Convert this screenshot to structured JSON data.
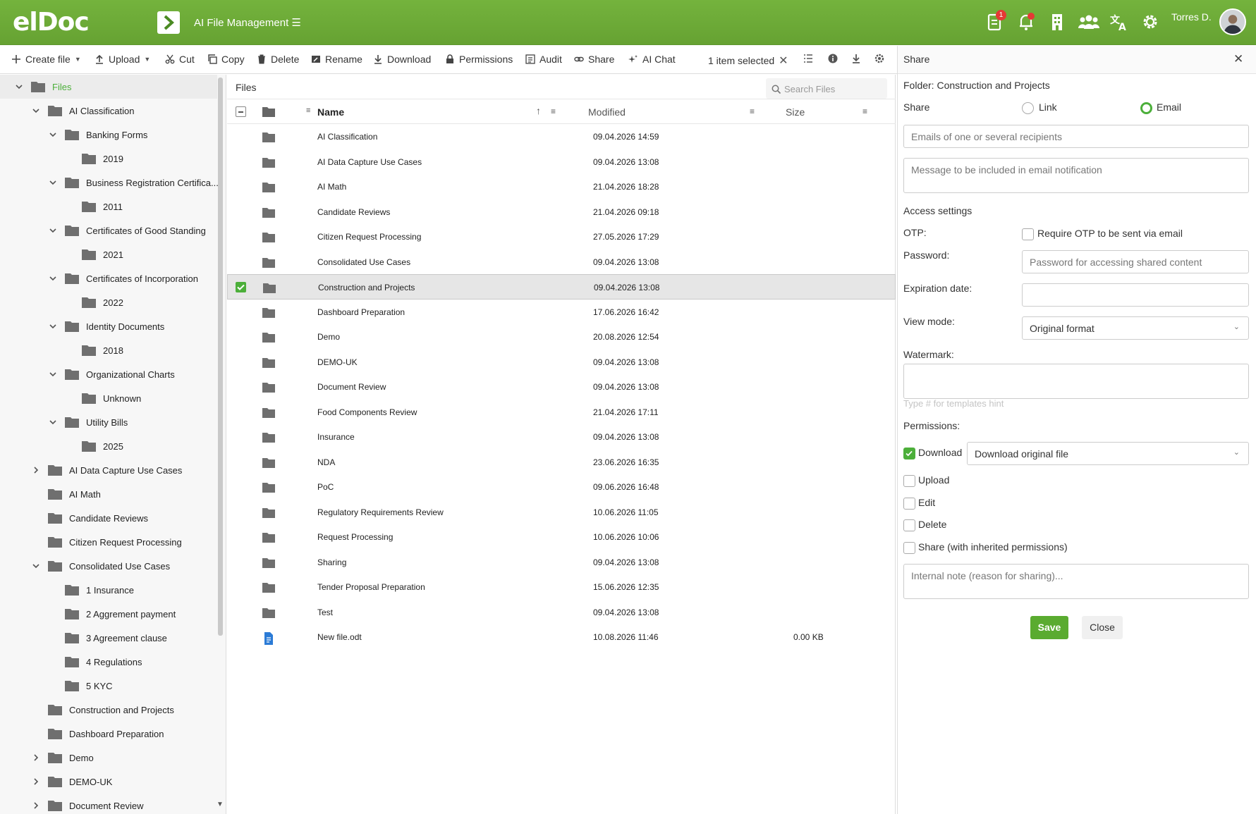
{
  "header": {
    "logo": "elDoc",
    "app_title": "AI File Management ☰",
    "notification_badge": "1",
    "user_name": "Torres D."
  },
  "toolbar": {
    "create_file": "Create file",
    "upload": "Upload",
    "cut": "Cut",
    "copy": "Copy",
    "delete": "Delete",
    "rename": "Rename",
    "download": "Download",
    "permissions": "Permissions",
    "audit": "Audit",
    "share": "Share",
    "ai_chat": "AI Chat",
    "selection_status": "1 item selected"
  },
  "tree": {
    "items": [
      {
        "label": "Files"
      },
      {
        "label": "AI Classification"
      },
      {
        "label": "Banking Forms"
      },
      {
        "label": "2019"
      },
      {
        "label": "Business Registration Certifica..."
      },
      {
        "label": "2011"
      },
      {
        "label": "Certificates of Good Standing"
      },
      {
        "label": "2021"
      },
      {
        "label": "Certificates of Incorporation"
      },
      {
        "label": "2022"
      },
      {
        "label": "Identity Documents"
      },
      {
        "label": "2018"
      },
      {
        "label": "Organizational Charts"
      },
      {
        "label": "Unknown"
      },
      {
        "label": "Utility Bills"
      },
      {
        "label": "2025"
      },
      {
        "label": "AI Data Capture Use Cases"
      },
      {
        "label": "AI Math"
      },
      {
        "label": "Candidate Reviews"
      },
      {
        "label": "Citizen Request Processing"
      },
      {
        "label": "Consolidated Use Cases"
      },
      {
        "label": "1 Insurance"
      },
      {
        "label": "2 Aggrement payment"
      },
      {
        "label": "3 Agreement clause"
      },
      {
        "label": "4 Regulations"
      },
      {
        "label": "5 KYC"
      },
      {
        "label": "Construction and Projects"
      },
      {
        "label": "Dashboard Preparation"
      },
      {
        "label": "Demo"
      },
      {
        "label": "DEMO-UK"
      },
      {
        "label": "Document Review"
      }
    ]
  },
  "list": {
    "title": "Files",
    "search_placeholder": "Search Files",
    "columns": {
      "name": "Name",
      "modified": "Modified",
      "size": "Size"
    },
    "rows": [
      {
        "name": "AI Classification",
        "modified": "09.04.2026 14:59",
        "size": ""
      },
      {
        "name": "AI Data Capture Use Cases",
        "modified": "09.04.2026 13:08",
        "size": ""
      },
      {
        "name": "AI Math",
        "modified": "21.04.2026 18:28",
        "size": ""
      },
      {
        "name": "Candidate Reviews",
        "modified": "21.04.2026 09:18",
        "size": ""
      },
      {
        "name": "Citizen Request Processing",
        "modified": "27.05.2026 17:29",
        "size": ""
      },
      {
        "name": "Consolidated Use Cases",
        "modified": "09.04.2026 13:08",
        "size": ""
      },
      {
        "name": "Construction and Projects",
        "modified": "09.04.2026 13:08",
        "size": ""
      },
      {
        "name": "Dashboard Preparation",
        "modified": "17.06.2026 16:42",
        "size": ""
      },
      {
        "name": "Demo",
        "modified": "20.08.2026 12:54",
        "size": ""
      },
      {
        "name": "DEMO-UK",
        "modified": "09.04.2026 13:08",
        "size": ""
      },
      {
        "name": "Document Review",
        "modified": "09.04.2026 13:08",
        "size": ""
      },
      {
        "name": "Food Components Review",
        "modified": "21.04.2026 17:11",
        "size": ""
      },
      {
        "name": "Insurance",
        "modified": "09.04.2026 13:08",
        "size": ""
      },
      {
        "name": "NDA",
        "modified": "23.06.2026 16:35",
        "size": ""
      },
      {
        "name": "PoC",
        "modified": "09.06.2026 16:48",
        "size": ""
      },
      {
        "name": "Regulatory Requirements Review",
        "modified": "10.06.2026 11:05",
        "size": ""
      },
      {
        "name": "Request Processing",
        "modified": "10.06.2026 10:06",
        "size": ""
      },
      {
        "name": "Sharing",
        "modified": "09.04.2026 13:08",
        "size": ""
      },
      {
        "name": "Tender Proposal Preparation",
        "modified": "15.06.2026 12:35",
        "size": ""
      },
      {
        "name": "Test",
        "modified": "09.04.2026 13:08",
        "size": ""
      },
      {
        "name": "New file.odt",
        "modified": "10.08.2026 11:46",
        "size": "0.00 KB"
      }
    ]
  },
  "share_panel": {
    "title": "Share",
    "folder": "Folder: Construction and Projects",
    "share_label": "Share",
    "option_link": "Link",
    "option_email": "Email",
    "recipients_placeholder": "Emails of one or several recipients",
    "message_placeholder": "Message to be included in email notification",
    "access_settings": "Access settings",
    "otp_label": "OTP:",
    "otp_option": "Require OTP to be sent via email",
    "password_label": "Password:",
    "password_placeholder": "Password for accessing shared content",
    "expiration_label": "Expiration date:",
    "view_mode_label": "View mode:",
    "view_mode_value": "Original format",
    "watermark_label": "Watermark:",
    "watermark_hint": "Type # for templates hint",
    "permissions_label": "Permissions:",
    "perm_download": "Download",
    "perm_download_value": "Download original file",
    "perm_upload": "Upload",
    "perm_edit": "Edit",
    "perm_delete": "Delete",
    "perm_share": "Share (with inherited permissions)",
    "note_placeholder": "Internal note (reason for sharing)...",
    "save": "Save",
    "close": "Close"
  },
  "colors": {
    "brand_green": "#6aa936",
    "accent_green": "#4caf3a",
    "folder_gray": "#6f6f6f",
    "file_blue": "#2b7bd6"
  }
}
